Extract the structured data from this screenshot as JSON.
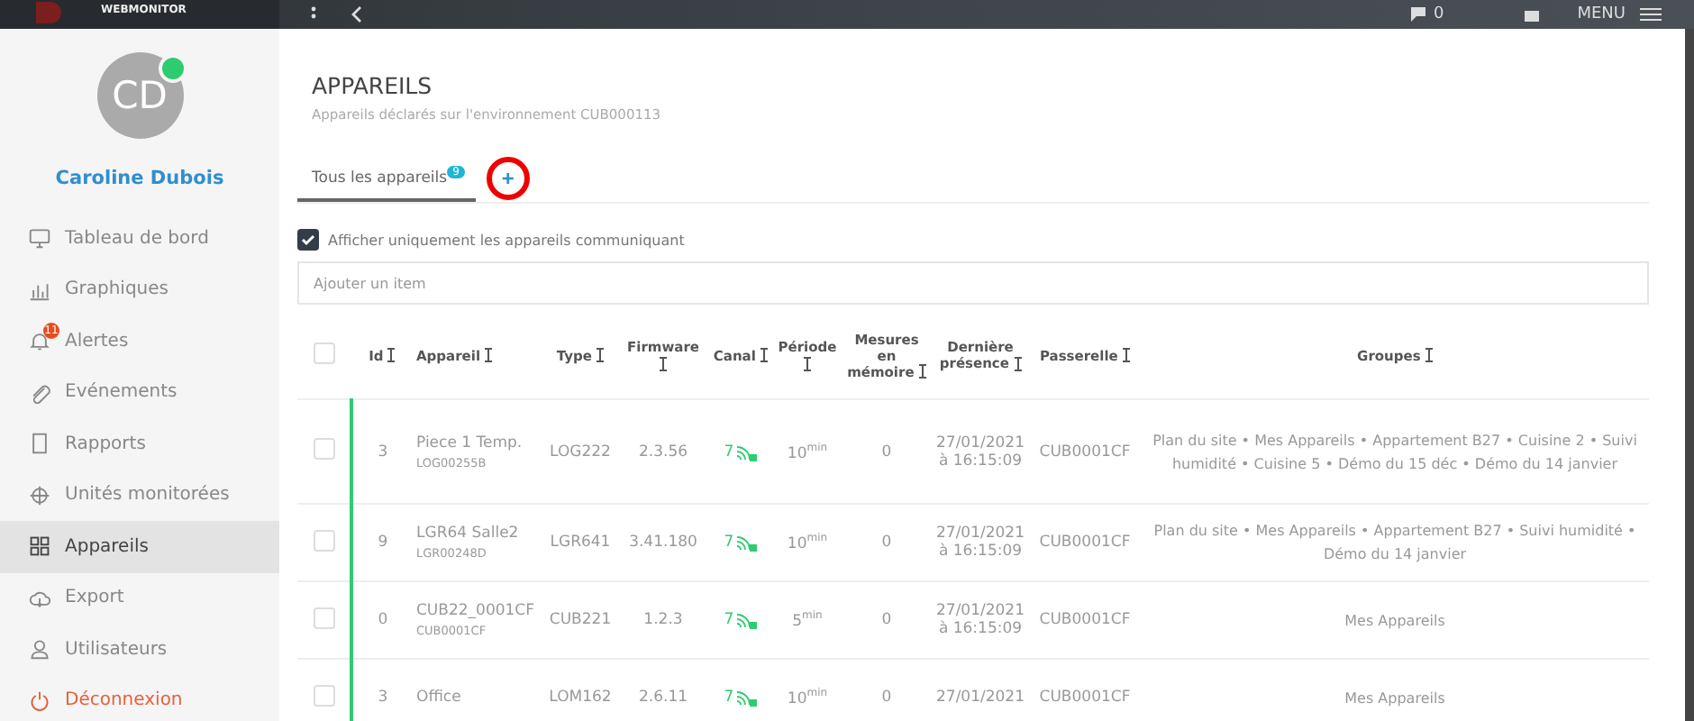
{
  "topbar": {
    "logo_subtitle": "WEBMONITOR",
    "messages_count": "0",
    "menu_label": "MENU"
  },
  "user": {
    "initials": "CD",
    "name": "Caroline Dubois",
    "online": true
  },
  "sidebar": {
    "items": [
      {
        "label": "Tableau de bord",
        "selected": false
      },
      {
        "label": "Graphiques",
        "selected": false
      },
      {
        "label": "Alertes",
        "selected": false,
        "badge": "11"
      },
      {
        "label": "Evénements",
        "selected": false
      },
      {
        "label": "Rapports",
        "selected": false
      },
      {
        "label": "Unités monitorées",
        "selected": false
      },
      {
        "label": "Appareils",
        "selected": true
      },
      {
        "label": "Export",
        "selected": false
      },
      {
        "label": "Utilisateurs",
        "selected": false
      },
      {
        "label": "Déconnexion",
        "selected": false,
        "kind": "danger"
      }
    ]
  },
  "page": {
    "title": "APPAREILS",
    "subtitle": "Appareils déclarés sur l'environnement CUB000113"
  },
  "tabs": [
    {
      "label": "Tous les appareils",
      "count": "9",
      "selected": true
    },
    {
      "label": "+",
      "kind": "add",
      "selected": false
    }
  ],
  "filter": {
    "label": "Afficher uniquement les appareils communiquant",
    "checked": true
  },
  "search": {
    "placeholder": "Ajouter un item"
  },
  "table": {
    "select_all_checked": false,
    "columns": [
      "Id",
      "Appareil",
      "Type",
      "Firmware",
      "Canal",
      "Période",
      "Mesures en mémoire",
      "Dernière présence",
      "Passerelle",
      "Groupes"
    ],
    "rows": [
      {
        "checked": false,
        "id": "3",
        "name": "Piece 1 Temp.",
        "serial": "LOG00255B",
        "type": "LOG222",
        "firmware": "2.3.56",
        "canal": "7",
        "period": "10",
        "period_unit": "min",
        "measures": "0",
        "date": "27/01/2021",
        "time": "à 16:15:09",
        "gateway": "CUB0001CF",
        "groups": "Plan du site • Mes Appareils • Appartement B27 • Cuisine 2 • Suivi humidité • Cuisine 5 • Démo du 15 déc • Démo du 14 janvier"
      },
      {
        "checked": false,
        "id": "9",
        "name": "LGR64 Salle2",
        "serial": "LGR00248D",
        "type": "LGR641",
        "firmware": "3.41.180",
        "canal": "7",
        "period": "10",
        "period_unit": "min",
        "measures": "0",
        "date": "27/01/2021",
        "time": "à 16:15:09",
        "gateway": "CUB0001CF",
        "groups": "Plan du site • Mes Appareils • Appartement B27 • Suivi humidité • Démo du 14 janvier"
      },
      {
        "checked": false,
        "id": "0",
        "name": "CUB22_0001CF",
        "serial": "CUB0001CF",
        "type": "CUB221",
        "firmware": "1.2.3",
        "canal": "7",
        "period": "5",
        "period_unit": "min",
        "measures": "0",
        "date": "27/01/2021",
        "time": "à 16:15:09",
        "gateway": "CUB0001CF",
        "groups": "Mes Appareils"
      },
      {
        "checked": false,
        "id": "3",
        "name": "Office",
        "type": "LOM162",
        "firmware": "2.6.11",
        "canal": "7",
        "period": "10",
        "period_unit": "min",
        "measures": "0",
        "date": "27/01/2021",
        "gateway": "CUB0001CF",
        "groups": "Mes Appareils"
      }
    ]
  }
}
